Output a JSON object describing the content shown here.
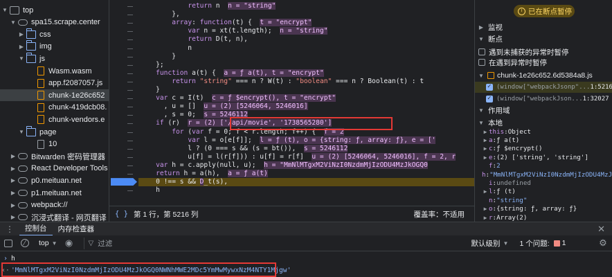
{
  "tree": {
    "items": [
      {
        "label": "top",
        "arrow": "▼",
        "icon": "frame"
      },
      {
        "label": "spa15.scrape.center",
        "arrow": "▼",
        "icon": "cloud"
      },
      {
        "label": "css",
        "arrow": "▶",
        "icon": "folder"
      },
      {
        "label": "img",
        "arrow": "▶",
        "icon": "folder"
      },
      {
        "label": "js",
        "arrow": "▼",
        "icon": "folder"
      },
      {
        "label": "Wasm.wasm",
        "arrow": "",
        "icon": "file"
      },
      {
        "label": "app.f2087057.js",
        "arrow": "",
        "icon": "file"
      },
      {
        "label": "chunk-1e26c652",
        "arrow": "",
        "icon": "file",
        "selected": true
      },
      {
        "label": "chunk-419dcb08.",
        "arrow": "",
        "icon": "file"
      },
      {
        "label": "chunk-vendors.e",
        "arrow": "",
        "icon": "file"
      },
      {
        "label": "page",
        "arrow": "▼",
        "icon": "folder"
      },
      {
        "label": "10",
        "arrow": "",
        "icon": "file-plain"
      },
      {
        "label": "Bitwarden 密码管理器",
        "arrow": "▶",
        "icon": "cloud"
      },
      {
        "label": "React Developer Tools",
        "arrow": "▶",
        "icon": "cloud"
      },
      {
        "label": "p0.meituan.net",
        "arrow": "▶",
        "icon": "cloud"
      },
      {
        "label": "p1.meituan.net",
        "arrow": "▶",
        "icon": "cloud"
      },
      {
        "label": "webpack://",
        "arrow": "▶",
        "icon": "cloud"
      },
      {
        "label": "沉浸式翻译 - 网页翻译",
        "arrow": "▶",
        "icon": "cloud"
      }
    ]
  },
  "editor": {
    "lines": [
      [
        {
          "t": "            "
        },
        {
          "t": "return",
          "c": "k"
        },
        {
          "t": " n  "
        },
        {
          "t": "n = \"string\"",
          "c": "inl"
        }
      ],
      [
        {
          "t": "        },"
        }
      ],
      [
        {
          "t": "        "
        },
        {
          "t": "array",
          "c": "k"
        },
        {
          "t": ": "
        },
        {
          "t": "function",
          "c": "k"
        },
        {
          "t": "(t) {  "
        },
        {
          "t": "t = \"encrypt\"",
          "c": "inl"
        }
      ],
      [
        {
          "t": "            "
        },
        {
          "t": "var",
          "c": "k"
        },
        {
          "t": " n = xt(t.length);  "
        },
        {
          "t": "n = \"string\"",
          "c": "inl"
        }
      ],
      [
        {
          "t": "            "
        },
        {
          "t": "return",
          "c": "k"
        },
        {
          "t": " D(t, n),"
        }
      ],
      [
        {
          "t": "            n"
        }
      ],
      [
        {
          "t": "        }"
        }
      ],
      [
        {
          "t": "    };"
        }
      ],
      [
        {
          "t": "    "
        },
        {
          "t": "function",
          "c": "k"
        },
        {
          "t": " a(t) {  "
        },
        {
          "t": "a = ƒ a(t), t = \"encrypt\"",
          "c": "inl"
        }
      ],
      [
        {
          "t": "        "
        },
        {
          "t": "return",
          "c": "k"
        },
        {
          "t": " "
        },
        {
          "t": "\"string\"",
          "c": "s"
        },
        {
          "t": " === n ? W(t) : "
        },
        {
          "t": "\"boolean\"",
          "c": "s"
        },
        {
          "t": " === n ? Boolean(t) : t"
        }
      ],
      [
        {
          "t": "    }"
        }
      ],
      [
        {
          "t": "    "
        },
        {
          "t": "var",
          "c": "k"
        },
        {
          "t": " c = I(t)  "
        },
        {
          "t": "c = ƒ $encrypt(), t = \"encrypt\"",
          "c": "inl"
        }
      ],
      [
        {
          "t": "      , u = []  "
        },
        {
          "t": "u = (2) [5246064, 5246016]",
          "c": "inl"
        }
      ],
      [
        {
          "t": "      , s = 0;  "
        },
        {
          "t": "s = 5246112",
          "c": "inl"
        }
      ],
      [
        {
          "t": "    "
        },
        {
          "t": "if",
          "c": "k"
        },
        {
          "t": " (r)  "
        },
        {
          "t": "r = (2) ['/api/movie', '1738565280']",
          "c": "inl"
        }
      ],
      [
        {
          "t": "        "
        },
        {
          "t": "for",
          "c": "k"
        },
        {
          "t": " ("
        },
        {
          "t": "var",
          "c": "k"
        },
        {
          "t": " f = 0; f < r.length; f++) {  "
        },
        {
          "t": "f = 2",
          "c": "inl"
        }
      ],
      [
        {
          "t": "            "
        },
        {
          "t": "var",
          "c": "k"
        },
        {
          "t": " l = o[e[f]];  "
        },
        {
          "t": "l = ƒ (t), o = {string: ƒ, array: ƒ}, e = ['",
          "c": "inl"
        }
      ],
      [
        {
          "t": "            l ? (0 === s && (s = bt()),  "
        },
        {
          "t": "s = 5246112",
          "c": "inl"
        }
      ],
      [
        {
          "t": "            u[f] = l(r[f])) : u[f] = r[f]  "
        },
        {
          "t": "u = (2) [5246064, 5246016], f = 2, r",
          "c": "inl"
        }
      ],
      [
        {
          "t": "    "
        },
        {
          "t": "var",
          "c": "k"
        },
        {
          "t": " h = c.apply(null, u);  "
        },
        {
          "t": "h = \"MmNlMTgxM2ViNzI0NzdmMjIzODU4MzJkOGQ0",
          "c": "inl"
        }
      ],
      [
        {
          "t": "    "
        },
        {
          "t": "return",
          "c": "k"
        },
        {
          "t": " h = a(h),  "
        },
        {
          "t": "a = ƒ a(t)",
          "c": "inl"
        }
      ],
      [
        {
          "t": "    0 !== s && "
        },
        {
          "t": "D",
          "c": "inl"
        },
        {
          "t": "_t(s),"
        }
      ],
      [
        {
          "t": "    h"
        }
      ]
    ]
  },
  "statusbar": {
    "braces": "{ }",
    "position": "第 1 行，第 5216 列",
    "coverage": "覆盖率：不适用"
  },
  "right": {
    "paused_label": "已在断点暂停",
    "watch": "监视",
    "breakpoints": "断点",
    "pause_uncaught": "遇到未捕获的异常时暂停",
    "pause_caught": "在遇到异常时暂停",
    "bp_file": "chunk-1e26c652.6d5384a8.js",
    "bp_items": [
      {
        "code": "(window[\"webpackJsonp\"...",
        "loc": "1:5216",
        "active": true
      },
      {
        "code": "(window[\"webpackJson...",
        "loc": "1:32027",
        "active": false
      }
    ],
    "scope": "作用域",
    "local": "本地",
    "scope_rows": [
      {
        "arrow": "▶",
        "k": "this",
        "v": "Object",
        "vc": "pv"
      },
      {
        "arrow": "▶",
        "k": "a",
        "v": "ƒ a(t)",
        "vc": "pv"
      },
      {
        "arrow": "▶",
        "k": "c",
        "v": "ƒ $encrypt()",
        "vc": "pv"
      },
      {
        "arrow": "▶",
        "k": "e",
        "v": "(2) ['string', 'string']",
        "vc": "pv"
      },
      {
        "arrow": "",
        "k": "f",
        "v": "2",
        "vc": "ps"
      },
      {
        "arrow": "",
        "k": "h",
        "v": "\"MmNlMTgxM2ViNzI0NzdmMjIzODU4MzJkOGQ",
        "vc": "ps"
      },
      {
        "arrow": "",
        "k": "i",
        "v": "undefined",
        "vc": "pu"
      },
      {
        "arrow": "▶",
        "k": "l",
        "v": "ƒ (t)",
        "vc": "pv"
      },
      {
        "arrow": "",
        "k": "n",
        "v": "\"string\"",
        "vc": "ps"
      },
      {
        "arrow": "▶",
        "k": "o",
        "v": "{string: ƒ, array: ƒ}",
        "vc": "pv"
      },
      {
        "arrow": "▶",
        "k": "r",
        "v": "Array(2)",
        "vc": "pv"
      }
    ]
  },
  "console": {
    "tab_console": "控制台",
    "tab_memory": "内存检查器",
    "context": "top",
    "filter_placeholder": "过滤",
    "level": "默认级别",
    "issues": "1 个问题:",
    "issue_count": "1",
    "input": "h",
    "output": "'MmNlMTgxM2ViNzI0NzdmMjIzODU4MzJkOGQ0NWNhMWE2MDc5YmMwMywxNzM4NTY1Mjgw'"
  },
  "colors": {
    "accent": "#8ab4f8",
    "paused": "#fdd663",
    "highlight": "#e53935"
  }
}
